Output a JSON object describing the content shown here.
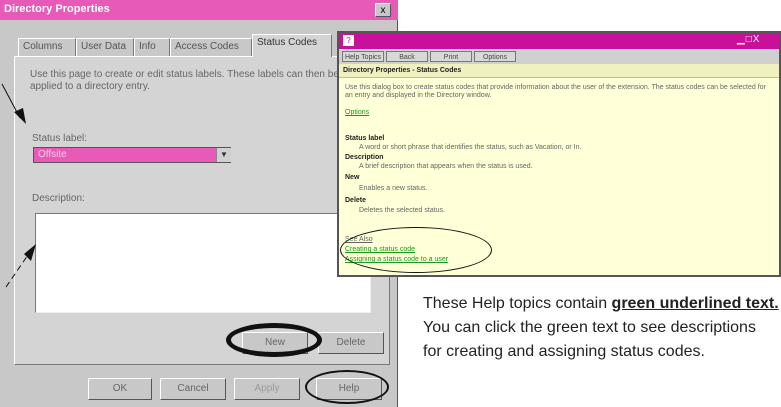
{
  "dialog": {
    "title": "Directory Properties",
    "close_glyph": "x",
    "tabs": [
      {
        "label": "Columns"
      },
      {
        "label": "User Data"
      },
      {
        "label": "Info"
      },
      {
        "label": "Access Codes"
      },
      {
        "label": "Status Codes",
        "active": true
      }
    ],
    "instructions_line1": "Use this page to create or edit status labels. These labels can then be",
    "instructions_line2": "applied to a directory entry.",
    "status_label": "Status label:",
    "status_value": "Offsite",
    "description_label": "Description:",
    "new_button": "New",
    "delete_button": "Delete",
    "ok_button": "OK",
    "cancel_button": "Cancel",
    "apply_button": "Apply",
    "help_button": "Help"
  },
  "help_window": {
    "icon_glyph": "?",
    "controls": "▁□X",
    "toolbar": [
      "Help Topics",
      "Back",
      "Print",
      "Options"
    ],
    "heading": "Directory Properties - Status Codes",
    "intro_line1": "Use this dialog box to create status codes that provide information about the user of the extension. The status codes can be selected for",
    "intro_line2": "an entry and displayed in the Directory window.",
    "options_link": "Options",
    "items": [
      {
        "term": "Status label",
        "desc": "A word or short phrase that identifies the status, such as Vacation, or In."
      },
      {
        "term": "Description",
        "desc": "A brief description that appears when the status is used."
      },
      {
        "term": "New",
        "desc": "Enables a new status."
      },
      {
        "term": "Delete",
        "desc": "Deletes the selected status."
      }
    ],
    "see_also": "See Also",
    "link1": "Creating a status code",
    "link2": "Assigning a status code to a user"
  },
  "caption": {
    "part1": "These Help topics contain ",
    "underlined": "green underlined text.",
    "part2": " You can click the green text to see descriptions for creating and assigning status codes."
  },
  "colors": {
    "title_pink": "#e85ab8",
    "help_title_magenta": "#c8109a",
    "help_bg": "#ffffd8",
    "link_green": "#1a9a1a"
  }
}
